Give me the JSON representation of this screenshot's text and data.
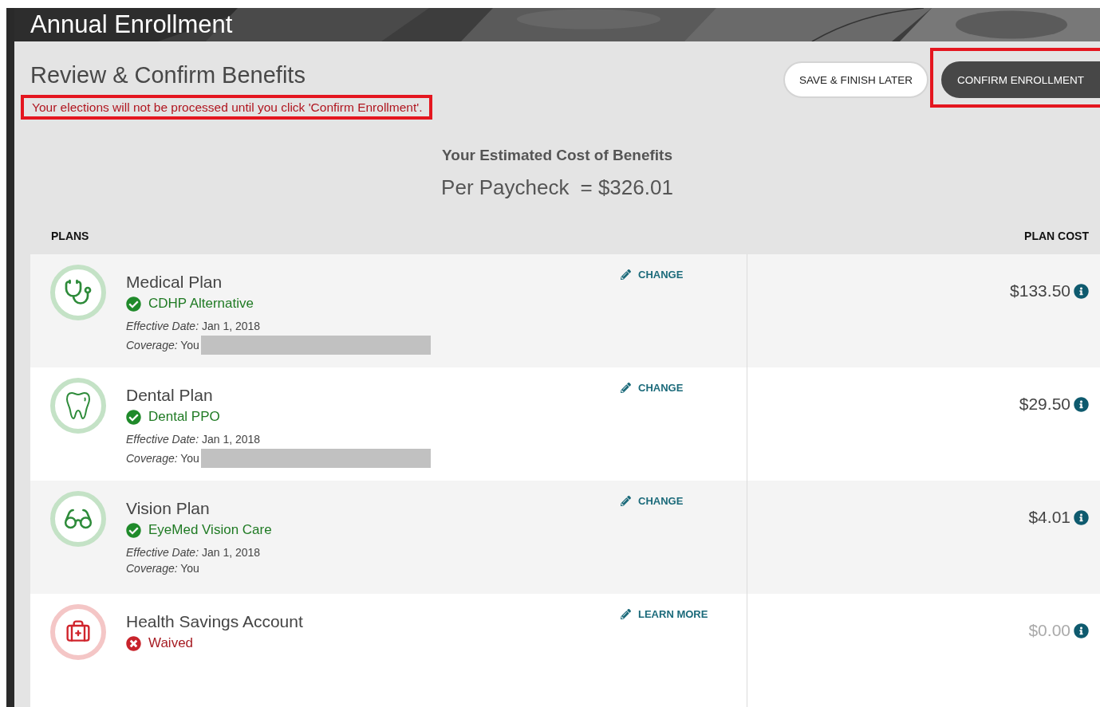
{
  "header": {
    "title": "Annual Enrollment"
  },
  "page": {
    "title": "Review & Confirm Benefits",
    "notice": {
      "text": "Your elections will not be processed until you click 'Confirm Enrollment'.",
      "highlighted": true
    }
  },
  "actions": [
    {
      "label": "SAVE & FINISH LATER",
      "kind": "secondary",
      "highlighted": false
    },
    {
      "label": "CONFIRM ENROLLMENT",
      "kind": "primary",
      "highlighted": true
    }
  ],
  "summary": {
    "heading": "Your Estimated Cost of Benefits",
    "label": "Per Paycheck",
    "amount": "= $326.01"
  },
  "table": {
    "columns": [
      "PLANS",
      "PLAN COST"
    ],
    "rows": [
      {
        "kind": "medical",
        "name": "Medical Plan",
        "waived": false,
        "selection": "CDHP Alternative",
        "effective_label": "Effective Date:",
        "effective": "Jan 1, 2018",
        "coverage_label": "Coverage:",
        "coverage": "You",
        "redacted": true,
        "action": "CHANGE",
        "cost": "$133.50",
        "cost_muted": false
      },
      {
        "kind": "dental",
        "name": "Dental Plan",
        "waived": false,
        "selection": "Dental PPO",
        "effective_label": "Effective Date:",
        "effective": "Jan 1, 2018",
        "coverage_label": "Coverage:",
        "coverage": "You",
        "redacted": true,
        "action": "CHANGE",
        "cost": "$29.50",
        "cost_muted": false
      },
      {
        "kind": "vision",
        "name": "Vision Plan",
        "waived": false,
        "selection": "EyeMed Vision Care",
        "effective_label": "Effective Date:",
        "effective": "Jan 1, 2018",
        "coverage_label": "Coverage:",
        "coverage": "You",
        "redacted": false,
        "action": "CHANGE",
        "cost": "$4.01",
        "cost_muted": false
      },
      {
        "kind": "hsa",
        "name": "Health Savings Account",
        "waived": true,
        "selection": "Waived",
        "action": "LEARN MORE",
        "cost": "$0.00",
        "cost_muted": true
      }
    ]
  }
}
